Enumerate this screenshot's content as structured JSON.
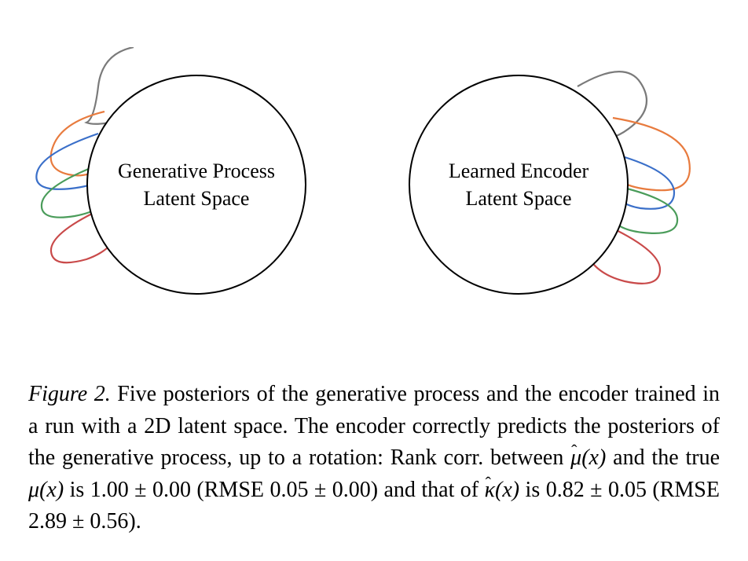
{
  "figure": {
    "left_circle": {
      "line1": "Generative Process",
      "line2": "Latent Space"
    },
    "right_circle": {
      "line1": "Learned Encoder",
      "line2": "Latent Space"
    }
  },
  "caption": {
    "label": "Figure 2.",
    "text_part1": " Five posteriors of the generative process and the encoder trained in a run with a 2D latent space. The encoder correctly predicts the posteriors of the generative process, up to a rotation: Rank corr. between ",
    "mu_hat": "μ",
    "arg1": "(x)",
    "text_part2": " and the true ",
    "mu": "μ",
    "arg2": "(x)",
    "text_part3": " is ",
    "val1": "1.00 ± 0.00",
    "text_part4": " (RMSE ",
    "val2": "0.05 ± 0.00",
    "text_part5": ") and that of ",
    "kappa_hat": "κ",
    "arg3": "(x)",
    "text_part6": " is ",
    "val3": "0.82 ± 0.05",
    "text_part7": " (RMSE ",
    "val4": "2.89 ± 0.56",
    "text_part8": ")."
  },
  "colors": {
    "gray": "#7a7a7a",
    "orange": "#e87b3e",
    "blue": "#3a6fc9",
    "green": "#4a9c5a",
    "red": "#c94a4a"
  }
}
